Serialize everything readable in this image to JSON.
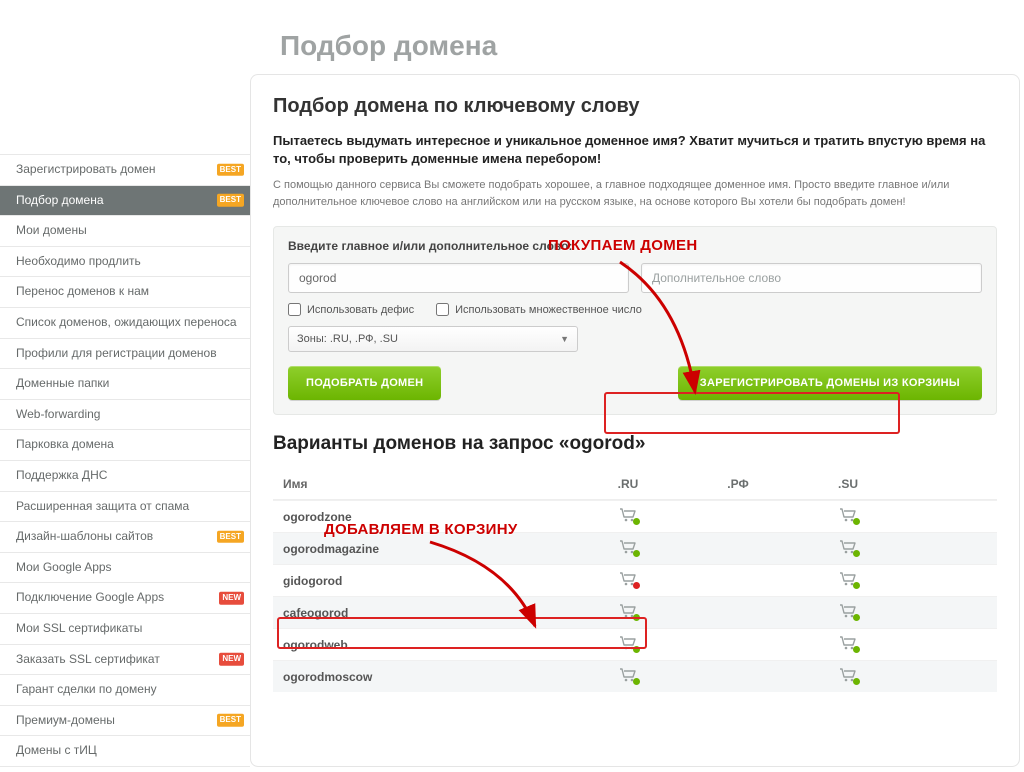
{
  "page_title": "Подбор домена",
  "sidebar": {
    "items": [
      {
        "label": "Зарегистрировать домен",
        "badge": "BEST",
        "badge_kind": "best"
      },
      {
        "label": "Подбор домена",
        "badge": "BEST",
        "badge_kind": "best",
        "active": true
      },
      {
        "label": "Мои домены"
      },
      {
        "label": "Необходимо продлить"
      },
      {
        "label": "Перенос доменов к нам"
      },
      {
        "label": "Список доменов, ожидающих переноса"
      },
      {
        "label": "Профили для регистрации доменов"
      },
      {
        "label": "Доменные папки"
      },
      {
        "label": "Web-forwarding"
      },
      {
        "label": "Парковка домена"
      },
      {
        "label": "Поддержка ДНС"
      },
      {
        "label": "Расширенная защита от спама"
      },
      {
        "label": "Дизайн-шаблоны сайтов",
        "badge": "BEST",
        "badge_kind": "best"
      },
      {
        "label": "Мои Google Apps"
      },
      {
        "label": "Подключение Google Apps",
        "badge": "NEW",
        "badge_kind": "new"
      },
      {
        "label": "Мои SSL сертификаты"
      },
      {
        "label": "Заказать SSL сертификат",
        "badge": "NEW",
        "badge_kind": "new"
      },
      {
        "label": "Гарант сделки по домену"
      },
      {
        "label": "Премиум-домены",
        "badge": "BEST",
        "badge_kind": "best"
      },
      {
        "label": "Домены с тИЦ"
      }
    ]
  },
  "main": {
    "heading": "Подбор домена по ключевому слову",
    "intro_strong": "Пытаетесь выдумать интересное и уникальное доменное имя? Хватит мучиться и тратить впустую время на то, чтобы проверить доменные имена перебором!",
    "intro_text": "С помощью данного сервиса Вы сможете подобрать хорошее, а главное подходящее доменное имя. Просто введите главное и/или дополнительное ключевое слово на английском или на русском языке, на основе которого Вы хотели бы подобрать домен!",
    "search": {
      "label": "Введите главное и/или дополнительное слово:",
      "main_value": "ogorod",
      "additional_placeholder": "Дополнительное слово",
      "check_hyphen": "Использовать дефис",
      "check_plural": "Использовать множественное число",
      "zones_select": "Зоны: .RU, .РФ, .SU",
      "btn_pick": "ПОДОБРАТЬ ДОМЕН",
      "btn_register": "ЗАРЕГИСТРИРОВАТЬ ДОМЕНЫ ИЗ КОРЗИНЫ"
    },
    "results": {
      "title": "Варианты доменов на запрос «ogorod»",
      "columns": {
        "name": "Имя",
        "ru": ".RU",
        "rf": ".РФ",
        "su": ".SU"
      },
      "rows": [
        {
          "name": "ogorodzone",
          "ru": "plus",
          "rf": "",
          "su": "plus"
        },
        {
          "name": "ogorodmagazine",
          "ru": "plus",
          "rf": "",
          "su": "plus"
        },
        {
          "name": "gidogorod",
          "ru": "minus",
          "rf": "",
          "su": "plus"
        },
        {
          "name": "cafeogorod",
          "ru": "plus",
          "rf": "",
          "su": "plus"
        },
        {
          "name": "ogorodweb",
          "ru": "plus",
          "rf": "",
          "su": "plus"
        },
        {
          "name": "ogorodmoscow",
          "ru": "plus",
          "rf": "",
          "su": "plus"
        }
      ]
    }
  },
  "annotations": {
    "buy": "ПОКУПАЕМ ДОМЕН",
    "add": "ДОБАВЛЯЕМ В КОРЗИНУ"
  }
}
